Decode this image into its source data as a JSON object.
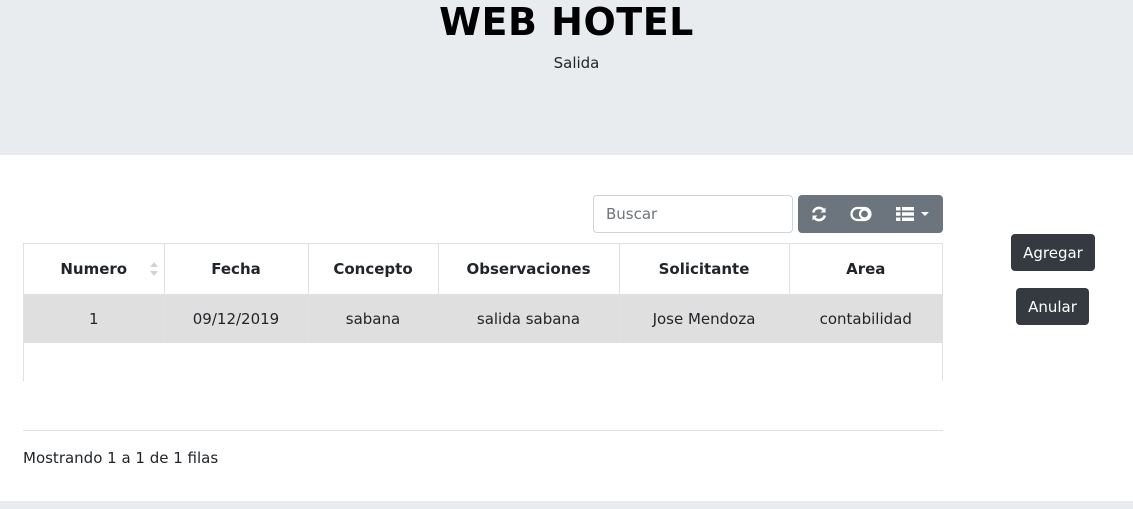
{
  "header": {
    "title": "WEB HOTEL",
    "subtitle": "Salida"
  },
  "toolbar": {
    "search_placeholder": "Buscar",
    "icons": [
      "refresh-icon",
      "toggle-icon",
      "columns-icon"
    ]
  },
  "table": {
    "columns": [
      "Numero",
      "Fecha",
      "Concepto",
      "Observaciones",
      "Solicitante",
      "Area"
    ],
    "rows": [
      [
        "1",
        "09/12/2019",
        "sabana",
        "salida sabana",
        "Jose Mendoza",
        "contabilidad"
      ]
    ]
  },
  "pagination": {
    "info": "Mostrando 1 a 1 de 1 filas"
  },
  "actions": {
    "add_label": "Agregar",
    "cancel_label": "Anular"
  },
  "colors": {
    "jumbotron": "#e9ecef",
    "toolbar_button": "#6c757d",
    "action_button": "#343a40",
    "selected_row": "#dfdfdf"
  }
}
